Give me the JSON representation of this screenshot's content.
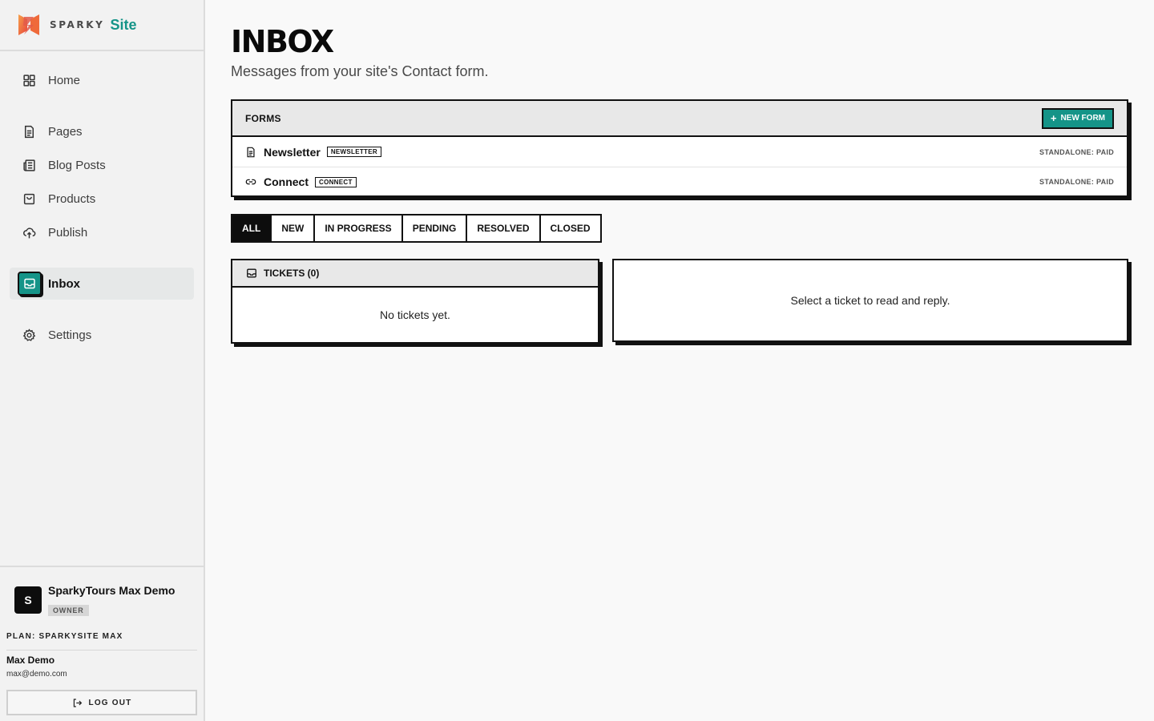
{
  "brand": {
    "word": "SPARKY",
    "site": "Site"
  },
  "nav": {
    "home": "Home",
    "pages": "Pages",
    "blog_posts": "Blog Posts",
    "products": "Products",
    "publish": "Publish",
    "inbox": "Inbox",
    "settings": "Settings"
  },
  "account": {
    "avatar_letter": "S",
    "name": "SparkyTours Max Demo",
    "role": "OWNER",
    "plan": "PLAN: SPARKYSITE MAX"
  },
  "user": {
    "name": "Max Demo",
    "email": "max@demo.com",
    "logout_label": "LOG OUT"
  },
  "page": {
    "title": "INBOX",
    "subtitle": "Messages from your site's Contact form."
  },
  "forms": {
    "header": "FORMS",
    "new_button": "NEW FORM",
    "items": [
      {
        "name": "Newsletter",
        "tag": "NEWSLETTER",
        "status": "STANDALONE: PAID",
        "icon": "document-icon"
      },
      {
        "name": "Connect",
        "tag": "CONNECT",
        "status": "STANDALONE: PAID",
        "icon": "link-icon"
      }
    ]
  },
  "filters": {
    "tabs": [
      "ALL",
      "NEW",
      "IN PROGRESS",
      "PENDING",
      "RESOLVED",
      "CLOSED"
    ],
    "active": "ALL"
  },
  "tickets": {
    "header": "TICKETS (0)",
    "empty": "No tickets yet."
  },
  "reader": {
    "placeholder": "Select a ticket to read and reply."
  },
  "colors": {
    "accent": "#159488",
    "ink": "#111111",
    "panel_header": "#e8e8e8"
  }
}
